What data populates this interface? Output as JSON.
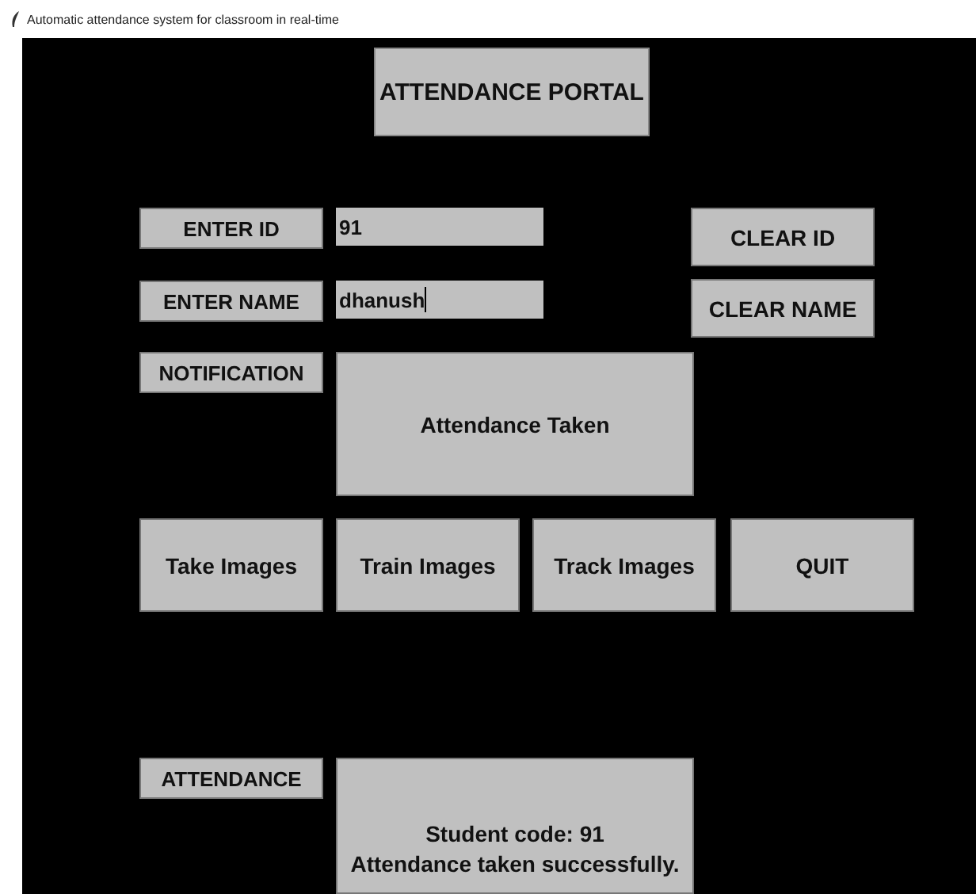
{
  "window": {
    "title": "Automatic attendance system for classroom in real-time"
  },
  "heading": "ATTENDANCE PORTAL",
  "fields": [
    {
      "label": "ENTER ID",
      "value": "91",
      "focused": false,
      "clear_button": "CLEAR ID"
    },
    {
      "label": "ENTER NAME",
      "value": "dhanush",
      "focused": true,
      "clear_button": "CLEAR NAME"
    }
  ],
  "notification": {
    "label": "NOTIFICATION",
    "message": "Attendance Taken"
  },
  "buttons": [
    "Take Images",
    "Train Images",
    "Track Images",
    "QUIT"
  ],
  "attendance": {
    "label": "ATTENDANCE",
    "lines": [
      "Student code: 91",
      "Attendance taken successfully."
    ]
  }
}
